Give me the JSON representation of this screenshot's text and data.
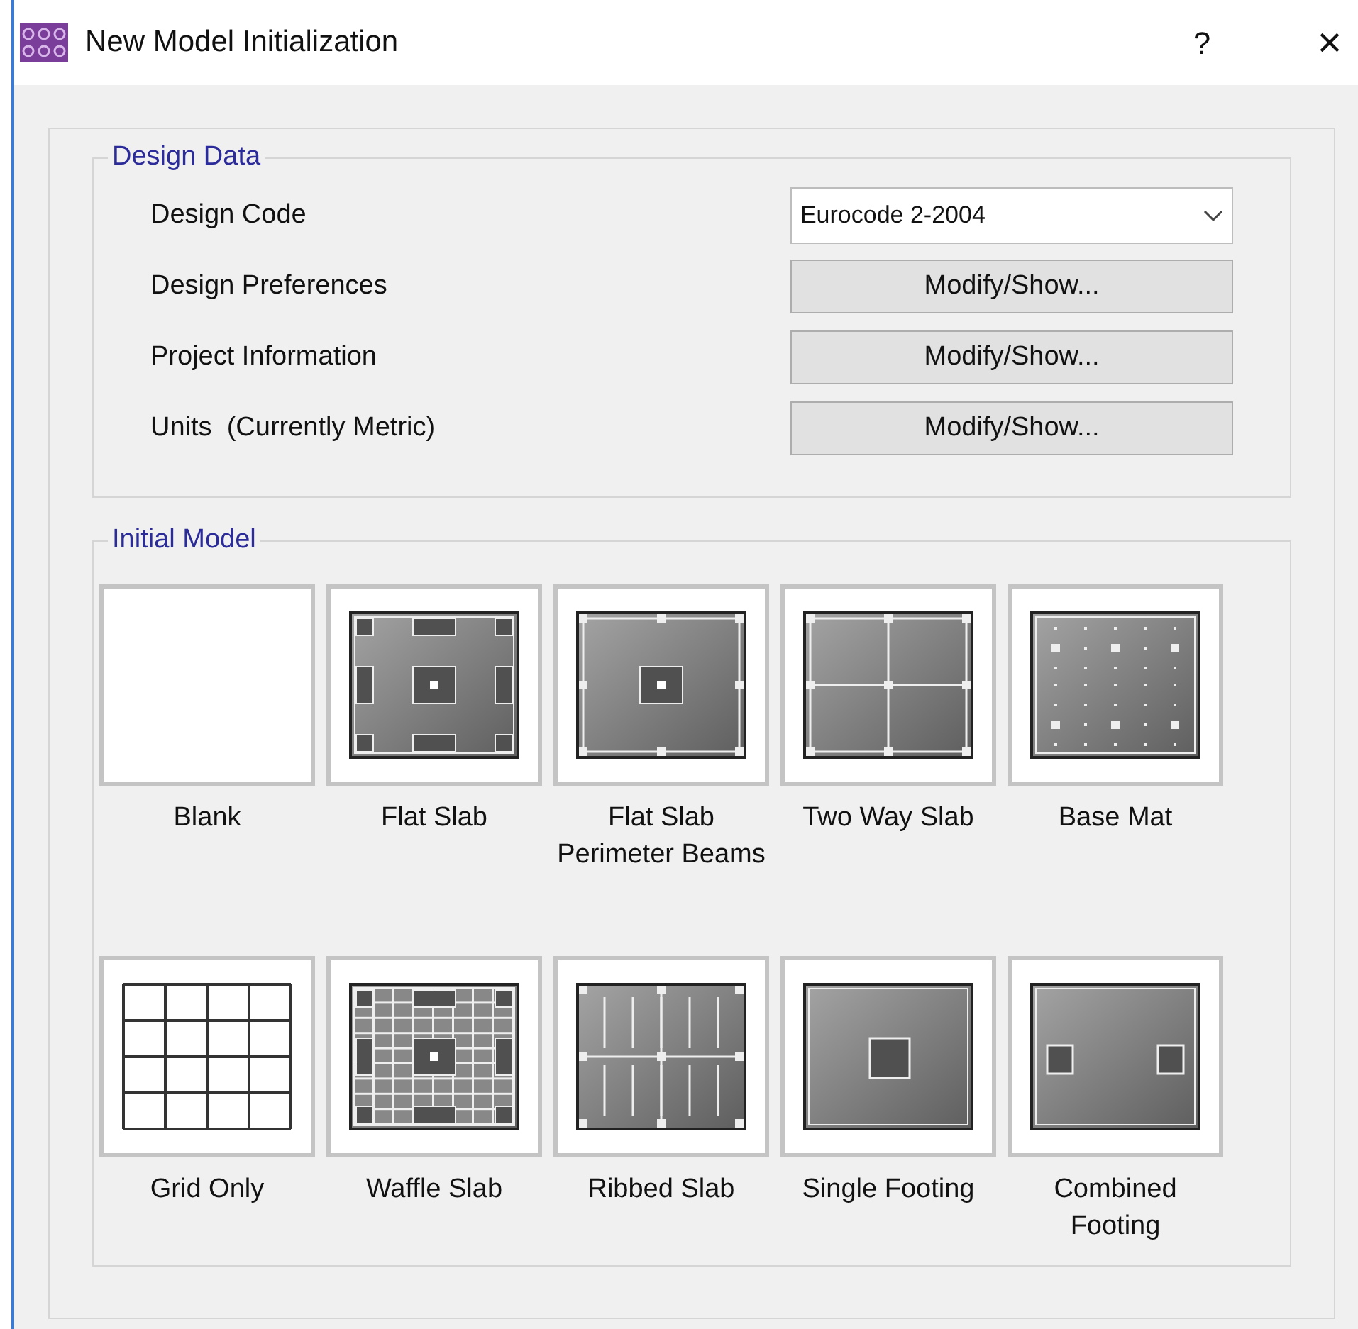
{
  "window": {
    "title": "New Model Initialization",
    "help": "?",
    "close": "×"
  },
  "design_data": {
    "title": "Design Data",
    "rows": [
      {
        "kind": "dropdown",
        "label": "Design Code",
        "value": "Eurocode 2-2004"
      },
      {
        "kind": "button",
        "label": "Design Preferences",
        "value": "Modify/Show..."
      },
      {
        "kind": "button",
        "label": "Project Information",
        "value": "Modify/Show..."
      },
      {
        "kind": "button",
        "label": "Units  (Currently Metric)",
        "value": "Modify/Show..."
      }
    ]
  },
  "initial_model": {
    "title": "Initial Model",
    "templates": [
      {
        "kind": "blank",
        "label": "Blank"
      },
      {
        "kind": "flat_slab",
        "label": "Flat Slab"
      },
      {
        "kind": "flat_slab_beams",
        "label": "Flat Slab Perimeter Beams"
      },
      {
        "kind": "two_way",
        "label": "Two Way Slab"
      },
      {
        "kind": "base_mat",
        "label": "Base Mat"
      },
      {
        "kind": "grid",
        "label": "Grid Only"
      },
      {
        "kind": "waffle",
        "label": "Waffle Slab"
      },
      {
        "kind": "ribbed",
        "label": "Ribbed Slab"
      },
      {
        "kind": "single_footing",
        "label": "Single Footing"
      },
      {
        "kind": "combined_footing",
        "label": "Combined Footing"
      }
    ]
  }
}
